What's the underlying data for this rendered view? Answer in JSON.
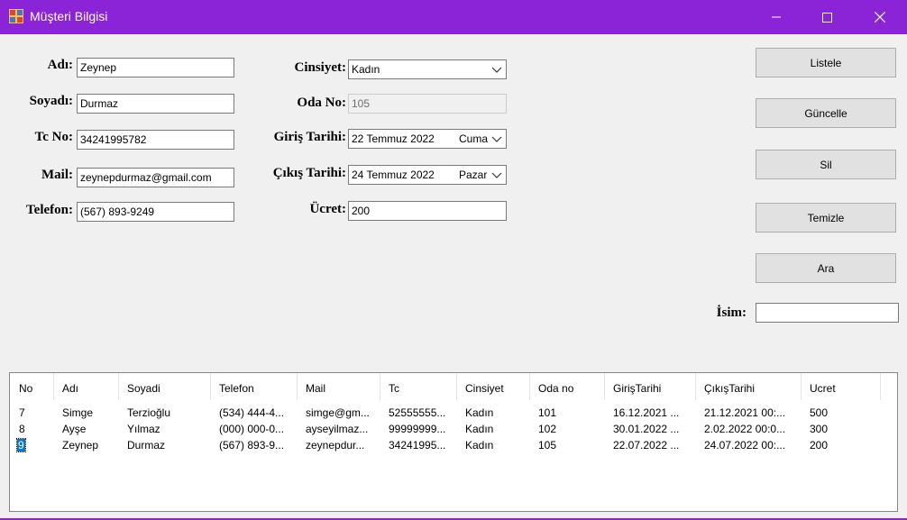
{
  "window": {
    "title": "Müşteri Bilgisi",
    "accent": "#8b24d6"
  },
  "form": {
    "adi": {
      "label": "Adı:",
      "value": "Zeynep"
    },
    "soyadi": {
      "label": "Soyadı:",
      "value": "Durmaz"
    },
    "tc": {
      "label": "Tc No:",
      "value": "34241995782"
    },
    "mail": {
      "label": "Mail:",
      "value": "zeynepdurmaz@gmail.com"
    },
    "telefon": {
      "label": "Telefon:",
      "value": "(567) 893-9249"
    },
    "cinsiyet": {
      "label": "Cinsiyet:",
      "value": "Kadın"
    },
    "oda_no": {
      "label": "Oda No:",
      "value": "105"
    },
    "giris": {
      "label": "Giriş Tarihi:",
      "value": "22 Temmuz 2022",
      "day": "Cuma"
    },
    "cikis": {
      "label": "Çıkış Tarihi:",
      "value": "24 Temmuz 2022",
      "day": "Pazar"
    },
    "ucret": {
      "label": "Ücret:",
      "value": "200"
    },
    "isim": {
      "label": "İsim:",
      "value": ""
    }
  },
  "buttons": {
    "listele": "Listele",
    "guncelle": "Güncelle",
    "sil": "Sil",
    "temizle": "Temizle",
    "ara": "Ara"
  },
  "grid": {
    "columns": [
      "No",
      "Adı",
      "Soyadi",
      "Telefon",
      "Mail",
      "Tc",
      "Cinsiyet",
      "Oda no",
      "GirişTarihi",
      "ÇıkışTarihi",
      "Ucret"
    ],
    "rows": [
      [
        "7",
        "Simge",
        "Terzioğlu",
        "(534) 444-4...",
        "simge@gm...",
        "52555555...",
        "Kadın",
        "101",
        "16.12.2021 ...",
        "21.12.2021 00:...",
        "500"
      ],
      [
        "8",
        "Ayşe",
        "Yılmaz",
        "(000) 000-0...",
        "ayseyilmaz...",
        "99999999...",
        "Kadın",
        "102",
        "30.01.2022 ...",
        "2.02.2022 00:0...",
        "300"
      ],
      [
        "9",
        "Zeynep",
        "Durmaz",
        "(567) 893-9...",
        "zeynepdur...",
        "34241995...",
        "Kadın",
        "105",
        "22.07.2022 ...",
        "24.07.2022 00:...",
        "200"
      ]
    ],
    "selected_row": 2
  }
}
